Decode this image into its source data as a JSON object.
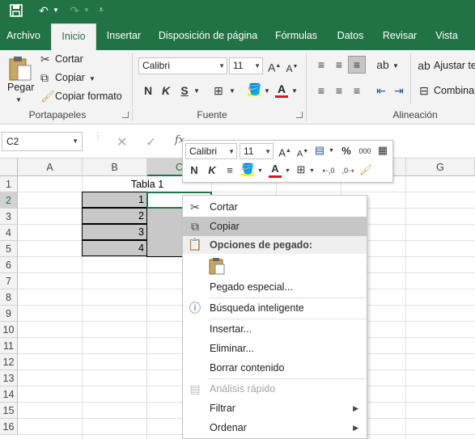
{
  "qat": {
    "save_icon": "save-icon",
    "undo_icon": "undo-icon",
    "redo_icon": "redo-icon",
    "customize_icon": "customize-qat-icon"
  },
  "tabs": [
    {
      "label": "Archivo"
    },
    {
      "label": "Inicio"
    },
    {
      "label": "Insertar"
    },
    {
      "label": "Disposición de página"
    },
    {
      "label": "Fórmulas"
    },
    {
      "label": "Datos"
    },
    {
      "label": "Revisar"
    },
    {
      "label": "Vista"
    }
  ],
  "ribbon": {
    "clipboard": {
      "paste": "Pegar",
      "cut": "Cortar",
      "copy": "Copiar",
      "format_painter": "Copiar formato",
      "group_label": "Portapapeles"
    },
    "font": {
      "font_name": "Calibri",
      "font_size": "11",
      "bold": "N",
      "italic": "K",
      "underline": "S",
      "group_label": "Fuente"
    },
    "alignment": {
      "wrap_text": "Ajustar te",
      "merge": "Combinar",
      "group_label": "Alineación"
    }
  },
  "formula_bar": {
    "name_box": "C2",
    "fx": "fx"
  },
  "sheet": {
    "columns": [
      "A",
      "B",
      "C",
      "D",
      "E",
      "F",
      "G"
    ],
    "rows": [
      "1",
      "2",
      "3",
      "4",
      "5",
      "6",
      "7",
      "8",
      "9",
      "10",
      "11",
      "12",
      "13",
      "14",
      "15",
      "16"
    ],
    "title_cell": "Tabla 1",
    "values": [
      "1",
      "2",
      "3",
      "4"
    ]
  },
  "mini_toolbar": {
    "font_name": "Calibri",
    "font_size": "11",
    "bold": "N",
    "italic": "K",
    "percent": "%",
    "thousands": "000",
    "font_color": "#e81123",
    "fill_color": "#ffff00"
  },
  "context_menu": {
    "cut": "Cortar",
    "copy": "Copiar",
    "paste_options": "Opciones de pegado:",
    "paste_special": "Pegado especial...",
    "smart_lookup": "Búsqueda inteligente",
    "insert": "Insertar...",
    "delete": "Eliminar...",
    "clear": "Borrar contenido",
    "quick_analysis": "Análisis rápido",
    "filter": "Filtrar",
    "sort": "Ordenar"
  },
  "colors": {
    "brand": "#217346",
    "selection_fill": "#c8c8c8",
    "menu_highlight": "#c6c6c6"
  }
}
